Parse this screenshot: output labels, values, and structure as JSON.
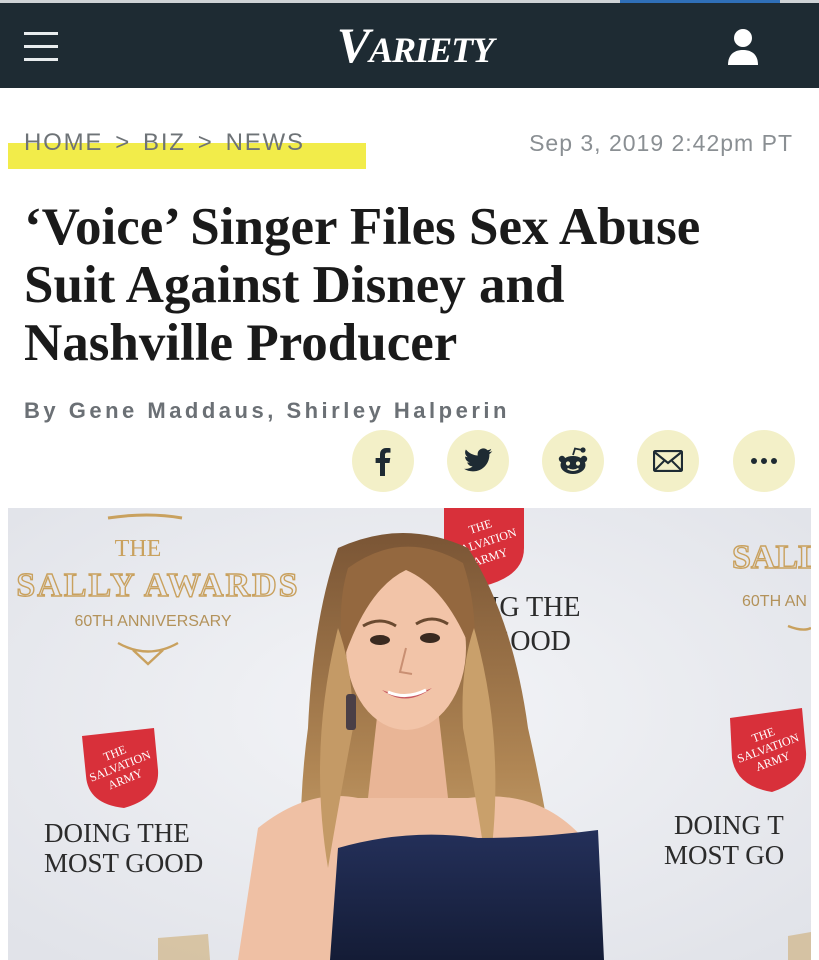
{
  "header": {
    "logo_text": "VARIETY",
    "logo_initial": "V",
    "logo_rest": "ARIETY"
  },
  "breadcrumb": {
    "items": [
      "HOME",
      "BIZ",
      "NEWS"
    ],
    "separator": ">",
    "highlight_color": "#f2ec4a"
  },
  "article": {
    "datetime": "Sep 3, 2019 2:42pm PT",
    "headline_line1": "‘Voice’ Singer Files Sex Abuse",
    "headline_line2": "Suit Against Disney and",
    "headline_line3": "Nashville Producer",
    "byline": "By Gene Maddaus, Shirley Halperin"
  },
  "share": {
    "buttons": [
      "facebook-icon",
      "twitter-icon",
      "reddit-icon",
      "email-icon",
      "more-icon"
    ],
    "bg_color": "#f3f0c8",
    "icon_color": "#1e2b33"
  },
  "photo": {
    "backdrop": {
      "award_left_the": "THE",
      "award_left_title": "SALLY AWARDS",
      "award_left_anniv": "60TH ANNIVERSARY",
      "award_right_title": "SALLY",
      "award_right_anniv": "60TH AN",
      "shield_text": "THE SALVATION ARMY",
      "doing_top_l1": "IG THE",
      "doing_top_l2": "GOOD",
      "doing_left_l1": "DOING THE",
      "doing_left_l2": "MOST GOOD",
      "doing_right_l1": "DOING T",
      "doing_right_l2": "MOST GO"
    },
    "colors": {
      "backdrop": "#e9ebef",
      "gold": "#c9a15e",
      "army_red": "#d8303a",
      "dress": "#1c2747",
      "hair": "#a77c4e",
      "skin": "#efc0a4"
    }
  }
}
